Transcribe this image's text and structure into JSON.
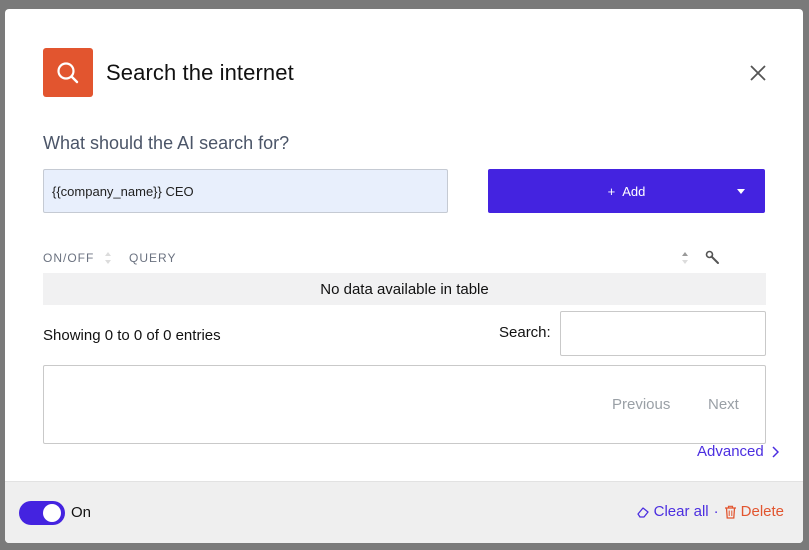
{
  "header": {
    "title": "Search the internet",
    "icon": "search-icon",
    "icon_color": "#e2552f"
  },
  "form": {
    "question": "What should the AI search for?",
    "query_value": "{{company_name}} CEO",
    "add_label": "Add",
    "add_prefix": "+",
    "accent": "#4423e0"
  },
  "table": {
    "columns": [
      "ON/OFF",
      "QUERY"
    ],
    "empty_message": "No data available in table",
    "info": "Showing 0 to 0 of 0 entries",
    "search_label": "Search:",
    "search_value": "",
    "previous_label": "Previous",
    "next_label": "Next"
  },
  "advanced_label": "Advanced",
  "footer": {
    "toggle_label": "On",
    "toggle_on": true,
    "clear_all_label": "Clear all",
    "separator": "·",
    "delete_label": "Delete",
    "delete_color": "#e2552f"
  }
}
